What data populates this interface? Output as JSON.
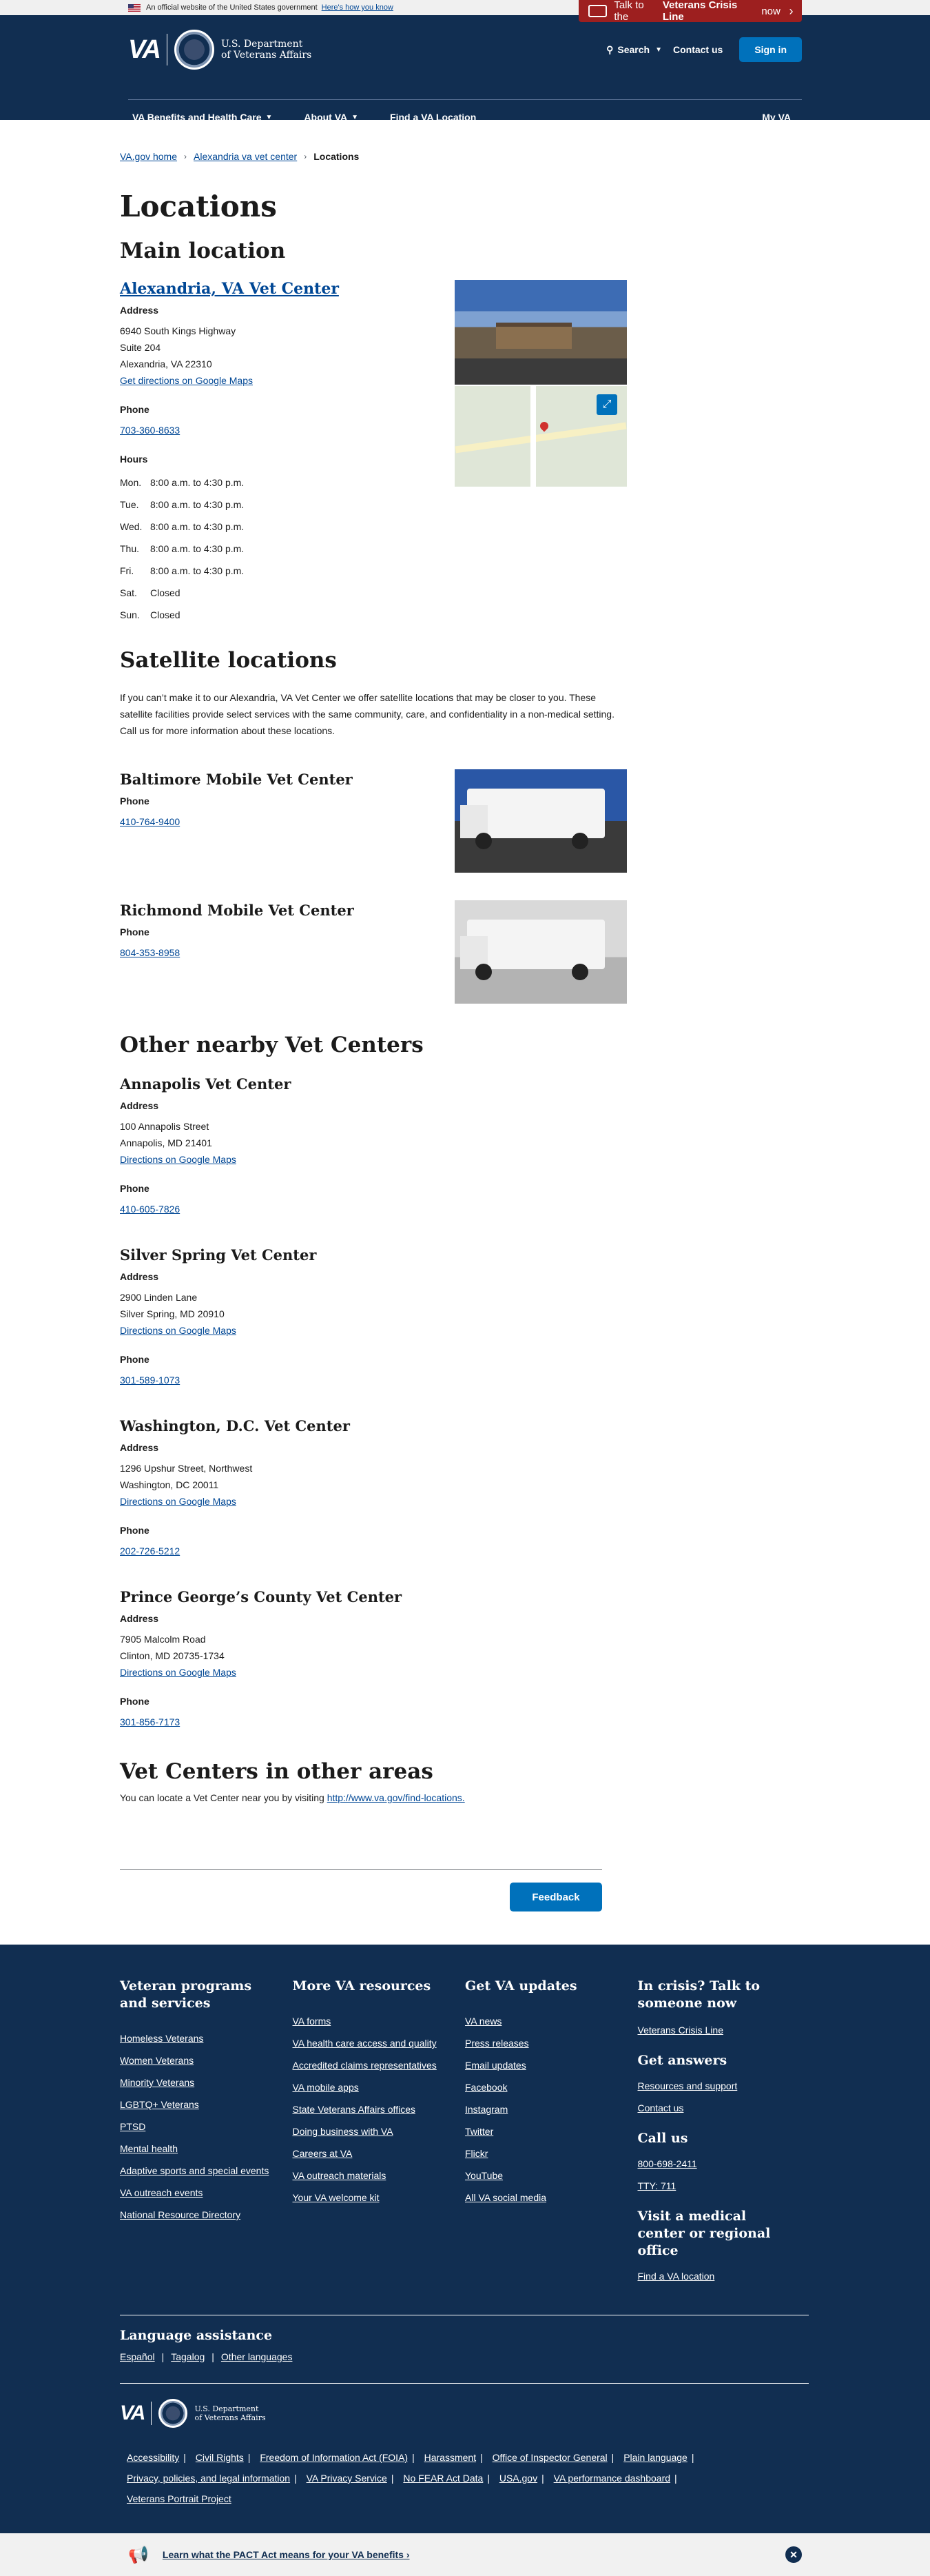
{
  "banner": {
    "official_text": "An official website of the United States government",
    "how_know": "Here's how you know",
    "crisis_prefix": "Talk to the",
    "crisis_bold": "Veterans Crisis Line",
    "crisis_suffix": "now"
  },
  "header": {
    "logo_va": "VA",
    "logo_line1": "U.S. Department",
    "logo_line2": "of Veterans Affairs",
    "search": "Search",
    "contact": "Contact us",
    "signin": "Sign in",
    "nav": [
      "VA Benefits and Health Care",
      "About VA",
      "Find a VA Location"
    ],
    "my_va": "My VA"
  },
  "breadcrumb": [
    "VA.gov home",
    "Alexandria va vet center",
    "Locations"
  ],
  "page_title": "Locations",
  "main_location": {
    "heading": "Main location",
    "name": "Alexandria, VA Vet Center",
    "address_label": "Address",
    "address": [
      "6940 South Kings Highway",
      "Suite 204",
      "Alexandria, VA 22310"
    ],
    "directions": "Get directions on Google Maps",
    "phone_label": "Phone",
    "phone": "703-360-8633",
    "hours_label": "Hours",
    "hours": [
      {
        "day": "Mon.",
        "time": "8:00 a.m. to 4:30 p.m."
      },
      {
        "day": "Tue.",
        "time": "8:00 a.m. to 4:30 p.m."
      },
      {
        "day": "Wed.",
        "time": "8:00 a.m. to 4:30 p.m."
      },
      {
        "day": "Thu.",
        "time": "8:00 a.m. to 4:30 p.m."
      },
      {
        "day": "Fri.",
        "time": "8:00 a.m. to 4:30 p.m."
      },
      {
        "day": "Sat.",
        "time": "Closed"
      },
      {
        "day": "Sun.",
        "time": "Closed"
      }
    ]
  },
  "satellite": {
    "heading": "Satellite locations",
    "intro": "If you can’t make it to our Alexandria, VA Vet Center we offer satellite locations that may be closer to you. These satellite facilities provide select services with the same community, care, and confidentiality in a non-medical setting. Call us for more information about these locations.",
    "locations": [
      {
        "name": "Baltimore Mobile Vet Center",
        "phone_label": "Phone",
        "phone": "410-764-9400"
      },
      {
        "name": "Richmond Mobile Vet Center",
        "phone_label": "Phone",
        "phone": "804-353-8958"
      }
    ]
  },
  "nearby": {
    "heading": "Other nearby Vet Centers",
    "centers": [
      {
        "name": "Annapolis Vet Center",
        "address_label": "Address",
        "address1": "100 Annapolis Street",
        "address2": "Annapolis, MD 21401",
        "directions": "Directions on Google Maps",
        "phone_label": "Phone",
        "phone": "410-605-7826"
      },
      {
        "name": "Silver Spring Vet Center",
        "address_label": "Address",
        "address1": "2900 Linden Lane",
        "address2": "Silver Spring, MD 20910",
        "directions": "Directions on Google Maps",
        "phone_label": "Phone",
        "phone": "301-589-1073"
      },
      {
        "name": "Washington, D.C. Vet Center",
        "address_label": "Address",
        "address1": "1296 Upshur Street, Northwest",
        "address2": "Washington, DC 20011",
        "directions": "Directions on Google Maps",
        "phone_label": "Phone",
        "phone": "202-726-5212"
      },
      {
        "name": "Prince George’s County Vet Center",
        "address_label": "Address",
        "address1": "7905 Malcolm Road",
        "address2": "Clinton, MD 20735-1734",
        "directions": "Directions on Google Maps",
        "phone_label": "Phone",
        "phone": "301-856-7173"
      }
    ]
  },
  "other_areas": {
    "heading": "Vet Centers in other areas",
    "text": "You can locate a Vet Center near you by visiting",
    "link": "http://www.va.gov/find-locations."
  },
  "feedback": "Feedback",
  "footer": {
    "col1": {
      "title": "Veteran programs and services",
      "links": [
        "Homeless Veterans",
        "Women Veterans",
        "Minority Veterans",
        "LGBTQ+ Veterans",
        "PTSD",
        "Mental health",
        "Adaptive sports and special events",
        "VA outreach events",
        "National Resource Directory"
      ]
    },
    "col2": {
      "title": "More VA resources",
      "links": [
        "VA forms",
        "VA health care access and quality",
        "Accredited claims representatives",
        "VA mobile apps",
        "State Veterans Affairs offices",
        "Doing business with VA",
        "Careers at VA",
        "VA outreach materials",
        "Your VA welcome kit"
      ]
    },
    "col3": {
      "title": "Get VA updates",
      "links": [
        "VA news",
        "Press releases",
        "Email updates",
        "Facebook",
        "Instagram",
        "Twitter",
        "Flickr",
        "YouTube",
        "All VA social media"
      ]
    },
    "col4": {
      "crisis_title": "In crisis? Talk to someone now",
      "crisis_link": "Veterans Crisis Line",
      "answers_title": "Get answers",
      "answers_links": [
        "Resources and support",
        "Contact us"
      ],
      "call_title": "Call us",
      "call_links": [
        "800-698-2411",
        "TTY: 711"
      ],
      "visit_title": "Visit a medical center or regional office",
      "visit_link": "Find a VA location"
    },
    "language_title": "Language assistance",
    "languages": [
      "Español",
      "Tagalog",
      "Other languages"
    ],
    "bottom_links": [
      "Accessibility",
      "Civil Rights",
      "Freedom of Information Act (FOIA)",
      "Harassment",
      "Office of Inspector General",
      "Plain language",
      "Privacy, policies, and legal information",
      "VA Privacy Service",
      "No FEAR Act Data",
      "USA.gov",
      "VA performance dashboard",
      "Veterans Portrait Project"
    ]
  },
  "pact": {
    "text": "Learn what the PACT Act means for your VA benefits"
  }
}
